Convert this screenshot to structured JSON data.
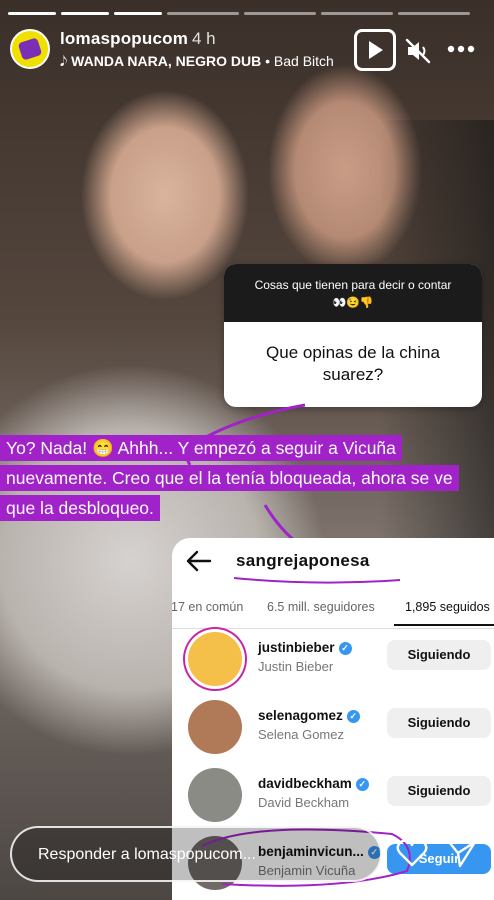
{
  "story": {
    "progress_total": 7,
    "progress_done": 3,
    "username": "lomaspopucom",
    "time": "4 h",
    "music": {
      "artists": "WANDA NARA, NEGRO DUB",
      "song": "Bad Bitch"
    }
  },
  "question_box": {
    "header": "Cosas que tienen para decir o contar",
    "header_emoji": "👀😉👎",
    "question": "Que opinas de la china suarez?"
  },
  "caption": {
    "lines": [
      "Yo? Nada! 😁 Ahhh... Y empezó a seguir a Vicuña",
      "nuevamente. Creo que el la tenía bloqueada, ahora se ve",
      "que la desbloqueo."
    ],
    "highlight_color": "#a122c9"
  },
  "profile_screenshot": {
    "username": "sangrejaponesa",
    "tabs": [
      "17 en común",
      "6.5 mill. seguidores",
      "1,895 seguidos"
    ],
    "active_tab": 2,
    "accounts": [
      {
        "handle": "justinbieber",
        "name": "Justin Bieber",
        "button": "Siguiendo"
      },
      {
        "handle": "selenagomez",
        "name": "Selena Gomez",
        "button": "Siguiendo"
      },
      {
        "handle": "davidbeckham",
        "name": "David Beckham",
        "button": "Siguiendo"
      },
      {
        "handle": "benjaminvicun...",
        "name": "Benjamin Vicuña",
        "button": "Seguir"
      }
    ]
  },
  "reply": {
    "placeholder": "Responder a lomaspopucom..."
  },
  "icons": {
    "play": "play-icon",
    "mute": "speaker-mute-icon",
    "more": "more-icon",
    "heart": "heart-icon",
    "send": "send-icon",
    "verified": "verified-badge-icon"
  },
  "colors": {
    "accent_purple": "#a122c9",
    "instagram_blue": "#3797f0"
  }
}
